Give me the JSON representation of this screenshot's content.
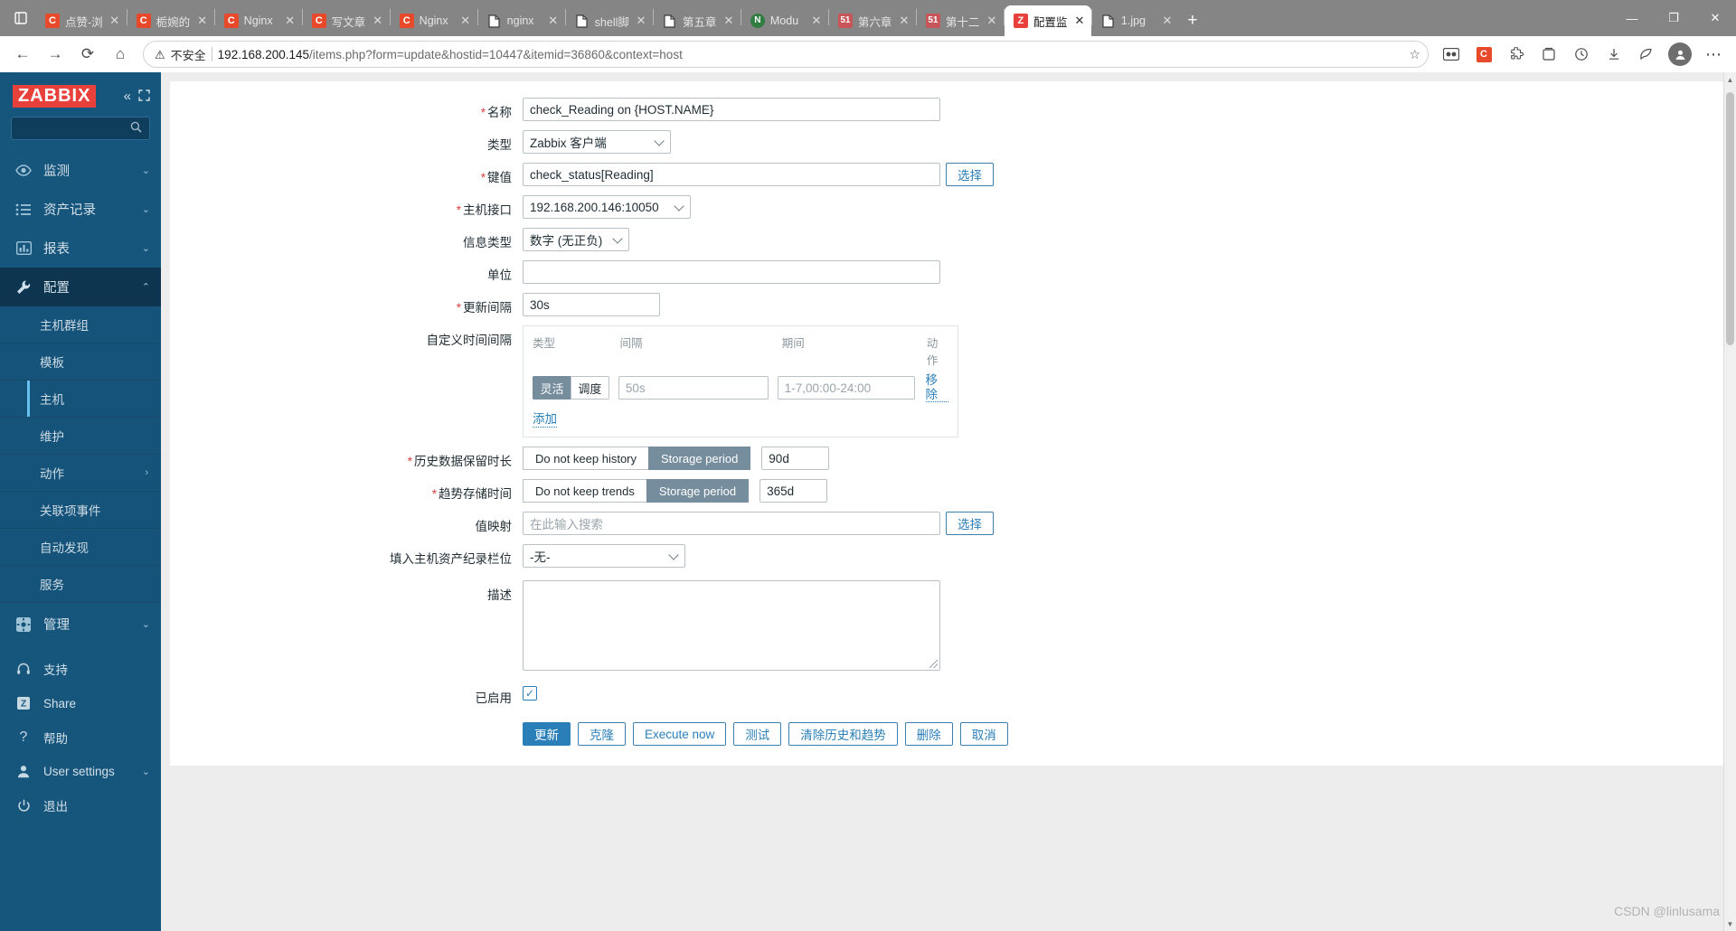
{
  "browser": {
    "tabs": [
      {
        "favicon": "chrome-c-icon",
        "kind": "c",
        "title": "点赞-浏",
        "active": false
      },
      {
        "favicon": "chrome-c-icon",
        "kind": "c",
        "title": "栀婉的",
        "active": false
      },
      {
        "favicon": "chrome-c-icon",
        "kind": "c",
        "title": "Nginx",
        "active": false
      },
      {
        "favicon": "chrome-c-icon",
        "kind": "c",
        "title": "写文章",
        "active": false
      },
      {
        "favicon": "chrome-c-icon",
        "kind": "c",
        "title": "Nginx",
        "active": false
      },
      {
        "favicon": "document-icon",
        "kind": "doc",
        "title": "nginx",
        "active": false
      },
      {
        "favicon": "document-icon",
        "kind": "doc",
        "title": "shell脚",
        "active": false
      },
      {
        "favicon": "document-icon",
        "kind": "doc",
        "title": "第五章",
        "active": false
      },
      {
        "favicon": "node-icon",
        "kind": "n",
        "title": "Modu",
        "active": false
      },
      {
        "favicon": "51cto-icon",
        "kind": "51",
        "title": "第六章",
        "active": false
      },
      {
        "favicon": "51cto-icon",
        "kind": "51",
        "title": "第十二",
        "active": false
      },
      {
        "favicon": "zabbix-icon",
        "kind": "z",
        "title": "配置监",
        "active": true
      },
      {
        "favicon": "document-icon",
        "kind": "doc",
        "title": "1.jpg",
        "active": false
      }
    ],
    "new_tab_label": "+",
    "window_controls": {
      "minimize": "—",
      "maximize": "❐",
      "close": "✕"
    },
    "toolbar": {
      "back": "←",
      "forward": "→",
      "reload": "⟳",
      "home": "⌂",
      "security_warning": "不安全",
      "url_host": "192.168.200.145",
      "url_path": "/items.php?form=update&hostid=10447&itemid=36860&context=host",
      "favorite": "☆",
      "collections": "collections-icon",
      "browser_essentials": "browser-essentials-icon",
      "history": "history-icon",
      "downloads": "downloads-icon",
      "more": "⋯"
    }
  },
  "sidebar": {
    "logo": "ZABBIX",
    "collapse_label": "«",
    "expand_label": "⛶",
    "search_placeholder": "",
    "search_icon": "search-icon",
    "items": [
      {
        "label": "监测",
        "icon": "eye-icon",
        "chevron": "⌄",
        "state": "collapsed"
      },
      {
        "label": "资产记录",
        "icon": "list-icon",
        "chevron": "⌄",
        "state": "collapsed"
      },
      {
        "label": "报表",
        "icon": "chart-icon",
        "chevron": "⌄",
        "state": "collapsed"
      },
      {
        "label": "配置",
        "icon": "wrench-icon",
        "chevron": "⌃",
        "state": "expanded"
      }
    ],
    "config_submenu": [
      {
        "label": "主机群组",
        "active": false,
        "chevron": ""
      },
      {
        "label": "模板",
        "active": false,
        "chevron": ""
      },
      {
        "label": "主机",
        "active": true,
        "chevron": ""
      },
      {
        "label": "维护",
        "active": false,
        "chevron": ""
      },
      {
        "label": "动作",
        "active": false,
        "chevron": "›"
      },
      {
        "label": "关联项事件",
        "active": false,
        "chevron": ""
      },
      {
        "label": "自动发现",
        "active": false,
        "chevron": ""
      },
      {
        "label": "服务",
        "active": false,
        "chevron": ""
      }
    ],
    "admin": {
      "label": "管理",
      "icon": "gear-icon",
      "chevron": "⌄"
    },
    "bottom_items": [
      {
        "label": "支持",
        "icon": "headset-icon"
      },
      {
        "label": "Share",
        "icon": "zabbix-share-icon"
      },
      {
        "label": "帮助",
        "icon": "question-icon"
      },
      {
        "label": "User settings",
        "icon": "user-icon",
        "chevron": "⌄"
      },
      {
        "label": "退出",
        "icon": "power-icon"
      }
    ]
  },
  "form": {
    "name": {
      "label": "名称",
      "required": true,
      "value": "check_Reading on {HOST.NAME}"
    },
    "type": {
      "label": "类型",
      "required": false,
      "value": "Zabbix 客户端"
    },
    "key": {
      "label": "键值",
      "required": true,
      "value": "check_status[Reading]",
      "select_button": "选择"
    },
    "host_interface": {
      "label": "主机接口",
      "required": true,
      "value": "192.168.200.146:10050"
    },
    "info_type": {
      "label": "信息类型",
      "required": false,
      "value": "数字 (无正负)"
    },
    "units": {
      "label": "单位",
      "required": false,
      "value": ""
    },
    "update_interval": {
      "label": "更新间隔",
      "required": true,
      "value": "30s"
    },
    "custom_intervals": {
      "label": "自定义时间间隔",
      "headers": {
        "type": "类型",
        "interval": "间隔",
        "period": "期间",
        "action": "动作"
      },
      "rows": [
        {
          "mode_flexible": "灵活",
          "mode_scheduling": "调度",
          "mode_selected": "灵活",
          "interval_placeholder": "50s",
          "interval_value": "",
          "period_placeholder": "1-7,00:00-24:00",
          "period_value": "",
          "remove_label": "移除"
        }
      ],
      "add_label": "添加"
    },
    "history": {
      "label": "历史数据保留时长",
      "required": true,
      "option_off": "Do not keep history",
      "option_on": "Storage period",
      "selected": "Storage period",
      "value": "90d"
    },
    "trends": {
      "label": "趋势存储时间",
      "required": true,
      "option_off": "Do not keep trends",
      "option_on": "Storage period",
      "selected": "Storage period",
      "value": "365d"
    },
    "value_map": {
      "label": "值映射",
      "placeholder": "在此输入搜索",
      "value": "",
      "select_button": "选择"
    },
    "inventory_field": {
      "label": "填入主机资产纪录栏位",
      "value": "-无-"
    },
    "description": {
      "label": "描述",
      "value": ""
    },
    "enabled": {
      "label": "已启用",
      "checked": true,
      "check_glyph": "✓"
    },
    "buttons": [
      {
        "label": "更新",
        "style": "primary",
        "name": "update-button"
      },
      {
        "label": "克隆",
        "style": "secondary",
        "name": "clone-button"
      },
      {
        "label": "Execute now",
        "style": "secondary",
        "name": "execute-now-button"
      },
      {
        "label": "测试",
        "style": "secondary",
        "name": "test-button"
      },
      {
        "label": "清除历史和趋势",
        "style": "secondary",
        "name": "clear-history-button"
      },
      {
        "label": "删除",
        "style": "secondary",
        "name": "delete-button"
      },
      {
        "label": "取消",
        "style": "secondary",
        "name": "cancel-button"
      }
    ]
  },
  "watermark": "CSDN @linlusama",
  "colors": {
    "zabbix_red": "#e8413c",
    "sidebar_blue": "#16557c",
    "accent_link": "#2b7fb8",
    "toggle_on": "#768d9e",
    "required_star": "#d93f3c"
  }
}
